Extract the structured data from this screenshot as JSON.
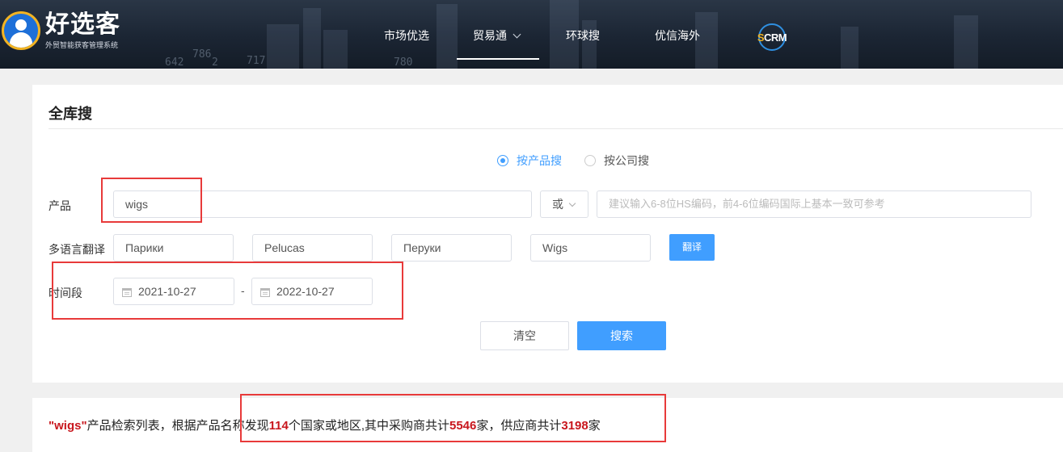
{
  "header": {
    "logo_title": "好选客",
    "logo_subtitle": "外贸智能获客管理系统",
    "nav": [
      {
        "label": "市场优选"
      },
      {
        "label": "贸易通"
      },
      {
        "label": "环球搜"
      },
      {
        "label": "优信海外"
      }
    ],
    "scrm_prefix": "S",
    "scrm_rest": "CRM",
    "bg_numbers": [
      "786",
      "642",
      "717",
      "780",
      "2"
    ]
  },
  "search": {
    "title": "全库搜",
    "mode_options": [
      {
        "label": "按产品搜",
        "selected": true
      },
      {
        "label": "按公司搜",
        "selected": false
      }
    ],
    "product_label": "产品",
    "product_value": "wigs",
    "or_label": "或",
    "hs_placeholder": "建议输入6-8位HS编码，前4-6位编码国际上基本一致可参考",
    "translate_label": "多语言翻译",
    "translations": [
      "Парики",
      "Pelucas",
      "Перуки",
      "Wigs"
    ],
    "translate_button": "翻译",
    "period_label": "时间段",
    "date_start": "2021-10-27",
    "date_separator": "-",
    "date_end": "2022-10-27",
    "clear_button": "清空",
    "search_button": "搜索"
  },
  "result": {
    "q_open": "\"",
    "keyword": "wigs",
    "q_close": "\"",
    "text1": "产品检索列表，根据产品名称发现",
    "countries": "114",
    "text2": "个国家或地区,其中采购商共计",
    "buyers": "5546",
    "text3": "家，供应商共计",
    "suppliers": "3198",
    "text4": "家"
  },
  "colors": {
    "accent": "#409eff",
    "highlight": "#c8161d",
    "annotation": "#e83a3a",
    "header_bg": "#1b2533"
  }
}
